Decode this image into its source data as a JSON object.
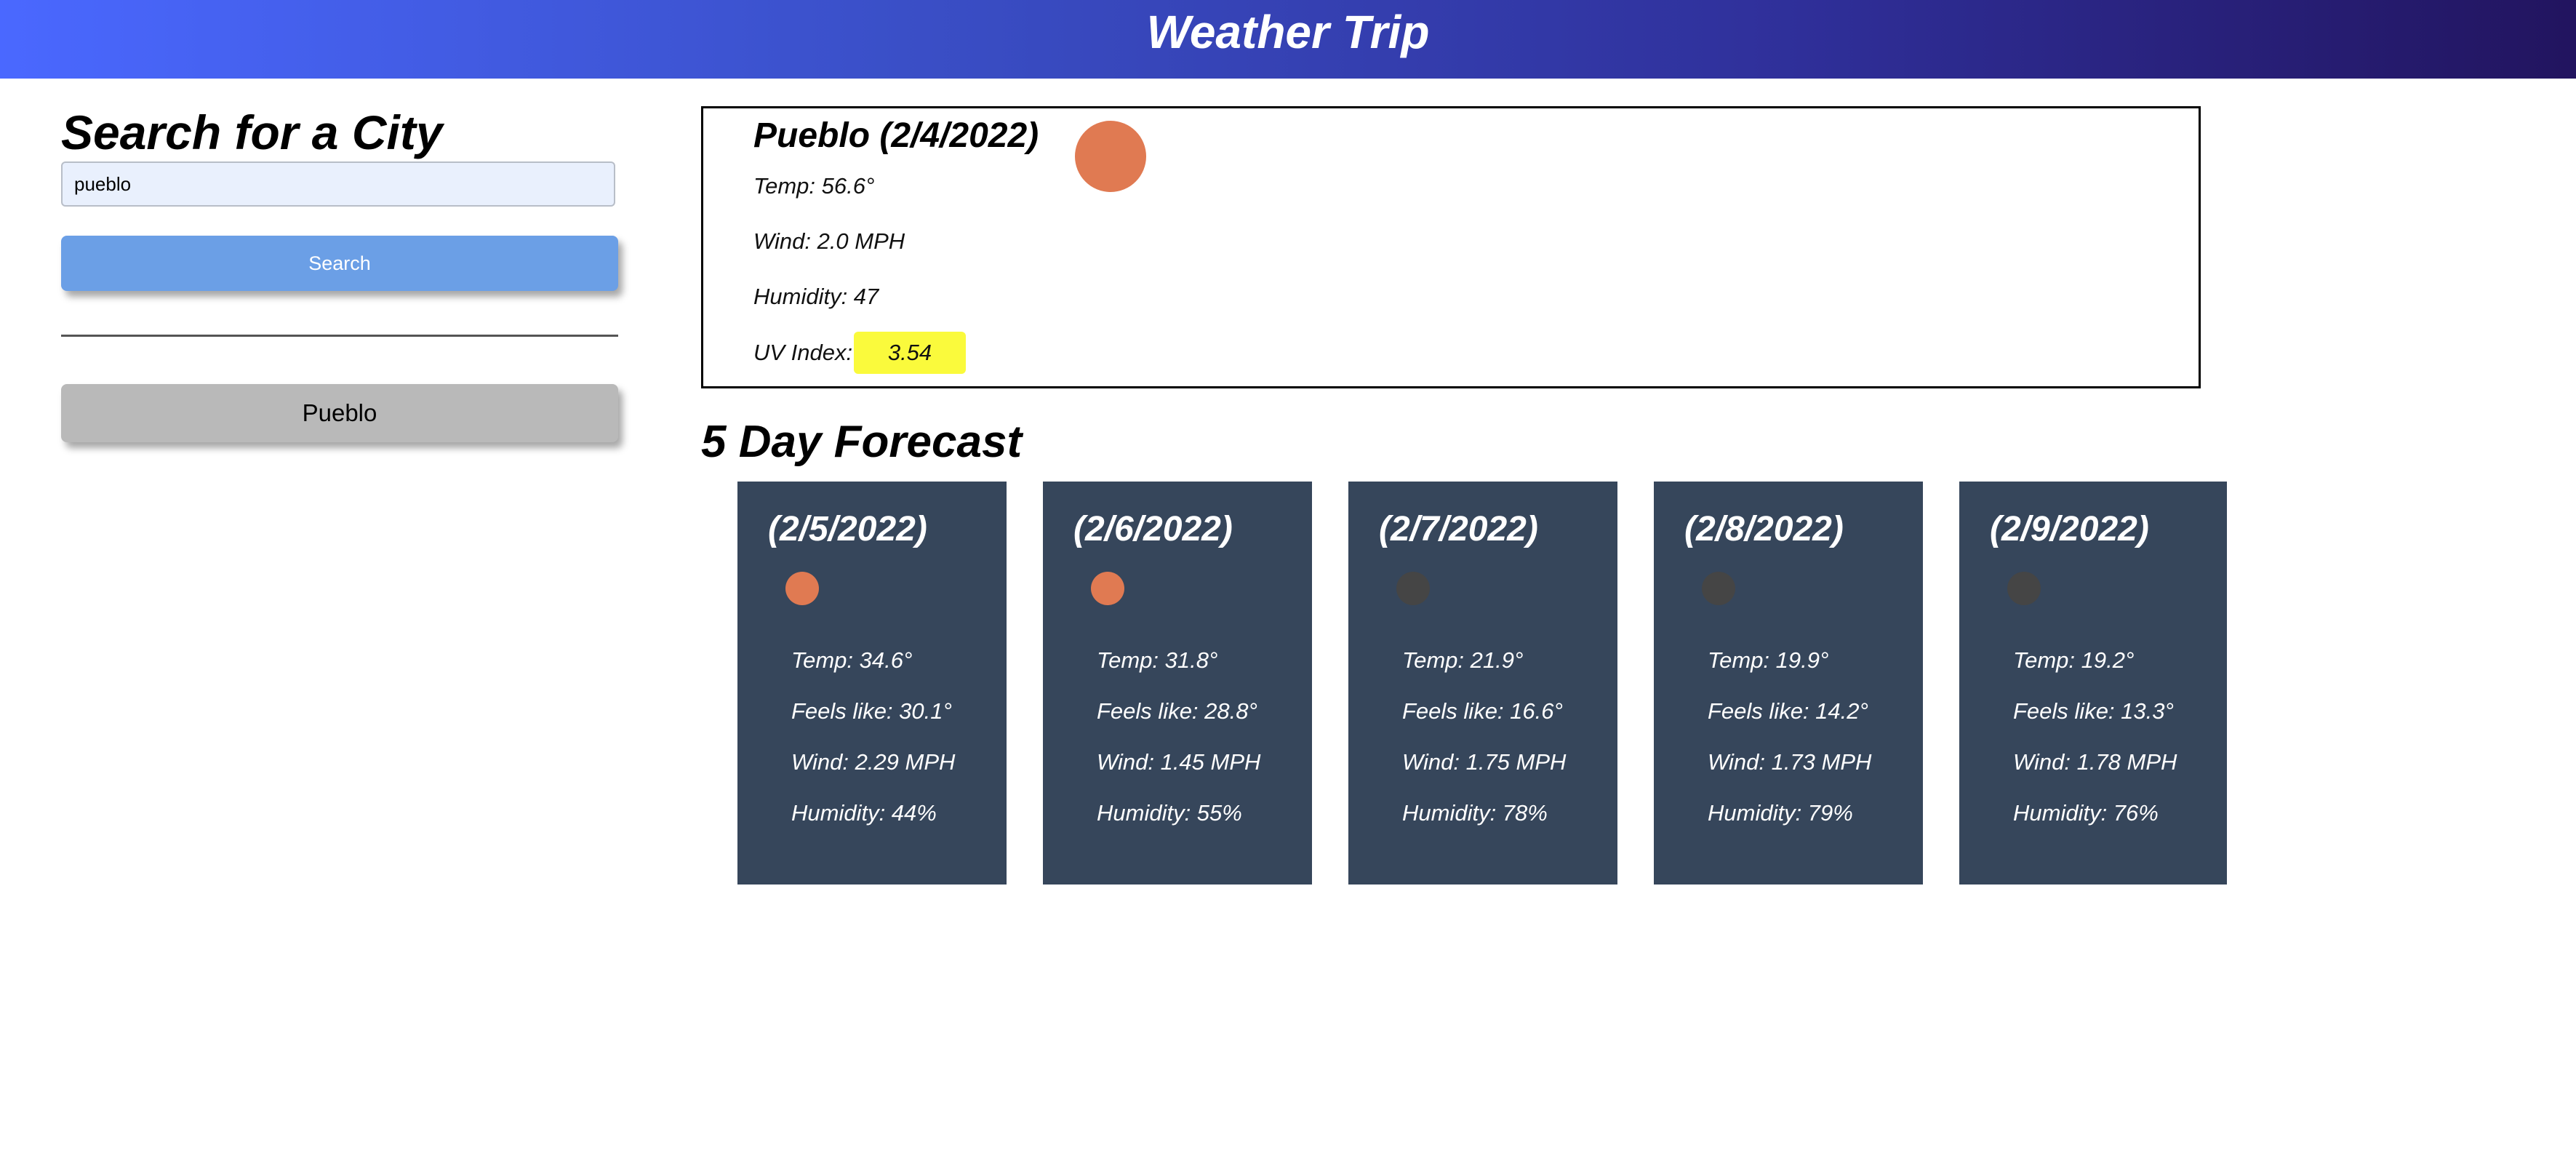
{
  "header": {
    "title": "Weather Trip"
  },
  "search": {
    "heading": "Search for a City",
    "input_value": "pueblo",
    "button_label": "Search"
  },
  "history": {
    "items": [
      "Pueblo"
    ]
  },
  "current": {
    "title": "Pueblo (2/4/2022)",
    "icon": "sun-icon",
    "icon_color": "#e07a52",
    "temp": "Temp: 56.6°",
    "wind": "Wind: 2.0 MPH",
    "humidity": "Humidity: 47",
    "uv_label": "UV Index:",
    "uv_value": "3.54",
    "uv_color": "#fafa3c"
  },
  "forecast": {
    "heading": "5 Day Forecast",
    "days": [
      {
        "date": "(2/5/2022)",
        "icon": "sun-icon",
        "icon_color": "#e07a52",
        "temp": "Temp: 34.6°",
        "feels": "Feels like: 30.1°",
        "wind": "Wind: 2.29 MPH",
        "humidity": "Humidity: 44%"
      },
      {
        "date": "(2/6/2022)",
        "icon": "sun-icon",
        "icon_color": "#e07a52",
        "temp": "Temp: 31.8°",
        "feels": "Feels like: 28.8°",
        "wind": "Wind: 1.45 MPH",
        "humidity": "Humidity: 55%"
      },
      {
        "date": "(2/7/2022)",
        "icon": "cloud-icon",
        "icon_color": "#454545",
        "temp": "Temp: 21.9°",
        "feels": "Feels like: 16.6°",
        "wind": "Wind: 1.75 MPH",
        "humidity": "Humidity: 78%"
      },
      {
        "date": "(2/8/2022)",
        "icon": "cloud-icon",
        "icon_color": "#454545",
        "temp": "Temp: 19.9°",
        "feels": "Feels like: 14.2°",
        "wind": "Wind: 1.73 MPH",
        "humidity": "Humidity: 79%"
      },
      {
        "date": "(2/9/2022)",
        "icon": "cloud-icon",
        "icon_color": "#454545",
        "temp": "Temp: 19.2°",
        "feels": "Feels like: 13.3°",
        "wind": "Wind: 1.78 MPH",
        "humidity": "Humidity: 76%"
      }
    ]
  },
  "colors": {
    "card_background": "#36465b",
    "search_button": "#6b9fe6",
    "history_button": "#b9b9b9"
  }
}
